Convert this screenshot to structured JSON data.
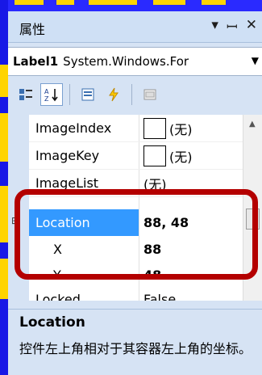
{
  "panel": {
    "title": "属性",
    "pin_glyph": "ꟷ ‡",
    "close_glyph": "✕"
  },
  "selector": {
    "object_name": "Label1",
    "object_type": "System.Windows.For"
  },
  "toolbar": {
    "buttons": [
      "categorized-icon",
      "alphabetical-icon",
      "properties-icon",
      "events-icon",
      "property-pages-icon"
    ]
  },
  "grid": {
    "rows": [
      {
        "name": "ImageIndex",
        "value": "(无)",
        "has_swatch": true
      },
      {
        "name": "ImageKey",
        "value": "(无)",
        "has_swatch": true
      },
      {
        "name": "ImageList",
        "value": "(无)",
        "has_swatch": false
      },
      {
        "name": "Location",
        "value": "88, 48",
        "selected": true
      },
      {
        "name": "X",
        "value": "88"
      },
      {
        "name": "Y",
        "value": "48"
      },
      {
        "name": "Locked",
        "value": "False"
      }
    ]
  },
  "description": {
    "title": "Location",
    "text": "控件左上角相对于其容器左上角的坐标。"
  }
}
